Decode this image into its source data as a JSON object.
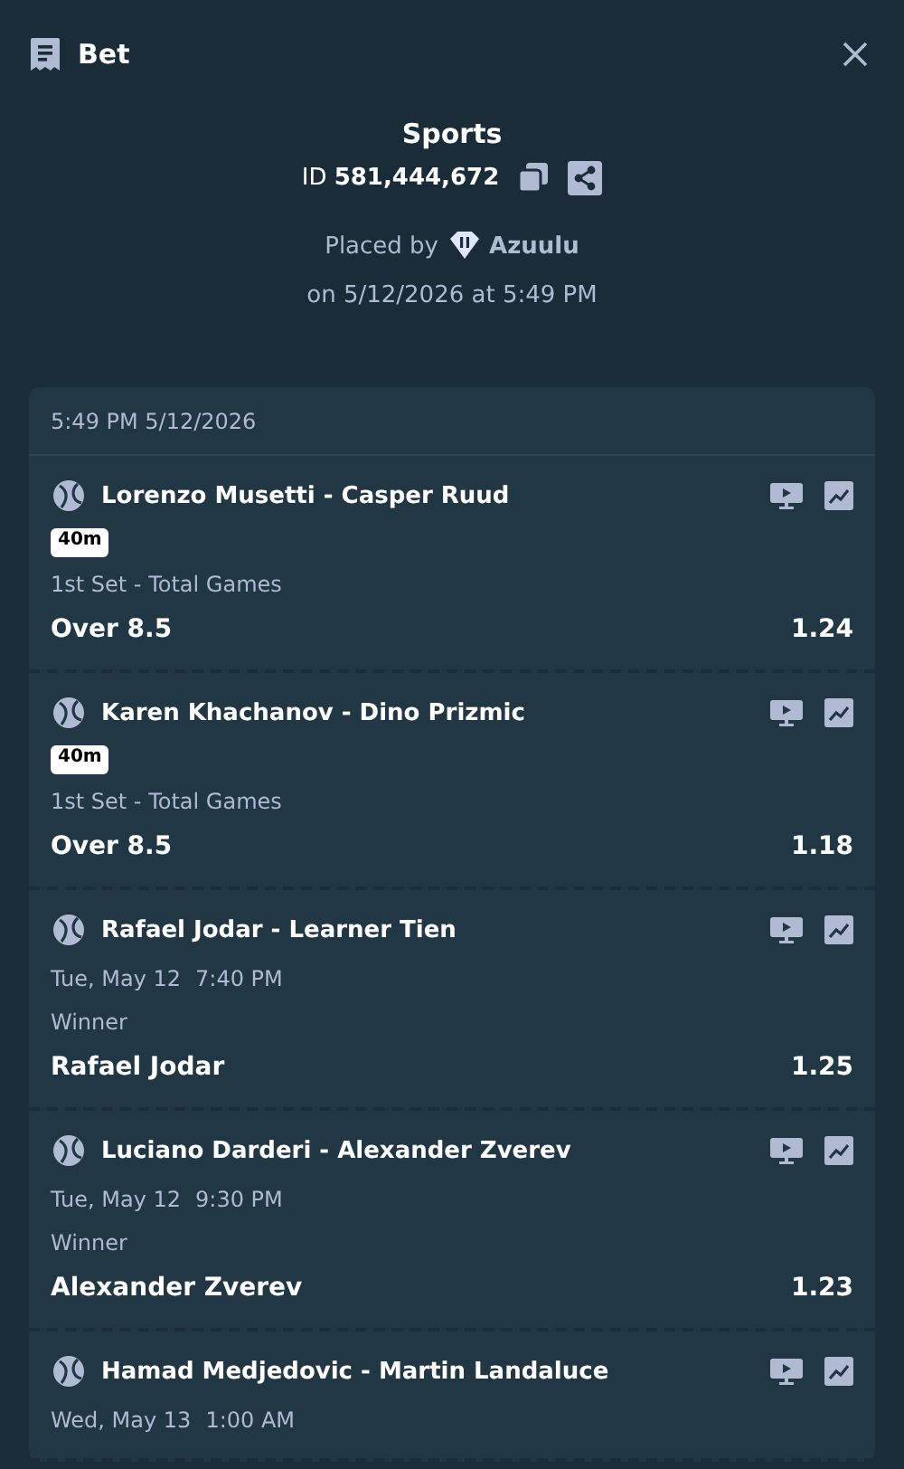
{
  "header": {
    "title": "Bet"
  },
  "summary": {
    "category": "Sports",
    "id_label": "ID",
    "id_value": "581,444,672",
    "placed_by_label": "Placed by",
    "user": "Azuulu",
    "placed_on": "on 5/12/2026 at 5:49 PM"
  },
  "slip": {
    "timestamp": "5:49 PM 5/12/2026",
    "legs": [
      {
        "kind": "live",
        "match": "Lorenzo Musetti - Casper Ruud",
        "badge": "40m",
        "market": "1st Set - Total Games",
        "selection": "Over 8.5",
        "odds": "1.24"
      },
      {
        "kind": "live",
        "match": "Karen Khachanov - Dino Prizmic",
        "badge": "40m",
        "market": "1st Set - Total Games",
        "selection": "Over 8.5",
        "odds": "1.18"
      },
      {
        "kind": "scheduled",
        "match": "Rafael Jodar - Learner Tien",
        "date": "Tue, May 12",
        "time": "7:40 PM",
        "market": "Winner",
        "selection": "Rafael Jodar",
        "odds": "1.25"
      },
      {
        "kind": "scheduled",
        "match": "Luciano Darderi - Alexander Zverev",
        "date": "Tue, May 12",
        "time": "9:30 PM",
        "market": "Winner",
        "selection": "Alexander Zverev",
        "odds": "1.23"
      },
      {
        "kind": "scheduled",
        "match": "Hamad Medjedovic - Martin Landaluce",
        "date": "Wed, May 13",
        "time": "1:00 AM"
      }
    ]
  }
}
